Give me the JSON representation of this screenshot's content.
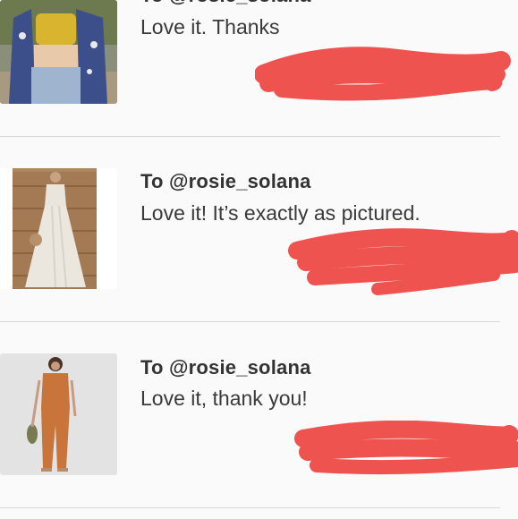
{
  "reviews": [
    {
      "to": "To @rosie_solana",
      "message": "Love it. Thanks",
      "product_image": "yellow-crop-top-floral-kimono-photo"
    },
    {
      "to": "To @rosie_solana",
      "message": "Love it! It’s exactly as pictured.",
      "product_image": "white-strapless-maxi-dress-photo"
    },
    {
      "to": "To @rosie_solana",
      "message": "Love it, thank you!",
      "product_image": "rust-jumpsuit-photo"
    }
  ],
  "colors": {
    "background": "#fafafa",
    "redaction": "#ef5350",
    "divider": "#d8d8d8"
  }
}
